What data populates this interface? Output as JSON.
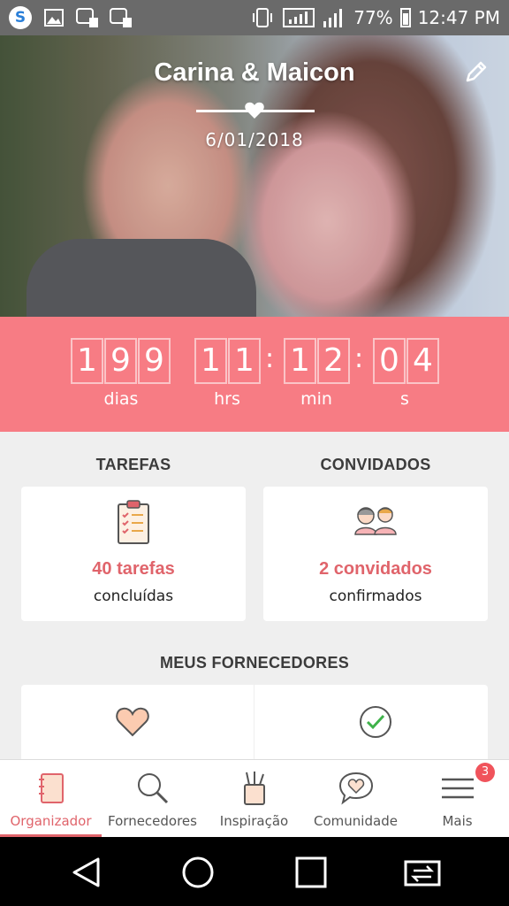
{
  "status_bar": {
    "battery": "77%",
    "time": "12:47 PM",
    "left_icons": [
      "skype-icon",
      "image-icon",
      "sim1-icon",
      "sim2-icon"
    ],
    "right_icons": [
      "vibrate-icon",
      "signal-box-icon",
      "cellular-signal-icon",
      "battery-icon"
    ]
  },
  "hero": {
    "couple_name": "Carina & Maicon",
    "date": "6/01/2018"
  },
  "countdown": {
    "days": [
      "1",
      "9",
      "9"
    ],
    "hours": [
      "1",
      "1"
    ],
    "minutes": [
      "1",
      "2"
    ],
    "seconds": [
      "0",
      "4"
    ],
    "labels": {
      "days": "dias",
      "hours": "hrs",
      "minutes": "min",
      "seconds": "s"
    }
  },
  "tasks": {
    "title": "TAREFAS",
    "value": "40 tarefas",
    "sub": "concluídas"
  },
  "guests": {
    "title": "CONVIDADOS",
    "value": "2 convidados",
    "sub": "confirmados"
  },
  "vendors": {
    "title": "MEUS FORNECEDORES"
  },
  "bottom_nav": {
    "items": [
      {
        "label": "Organizador",
        "icon": "notebook-icon",
        "active": true
      },
      {
        "label": "Fornecedores",
        "icon": "search-icon"
      },
      {
        "label": "Inspiração",
        "icon": "pencil-cup-icon"
      },
      {
        "label": "Comunidade",
        "icon": "chat-heart-icon"
      },
      {
        "label": "Mais",
        "icon": "menu-icon"
      }
    ],
    "badge": "3"
  },
  "colors": {
    "accent": "#f77c84",
    "accent_text": "#e0646b",
    "status_bar": "#6a6a6a"
  }
}
